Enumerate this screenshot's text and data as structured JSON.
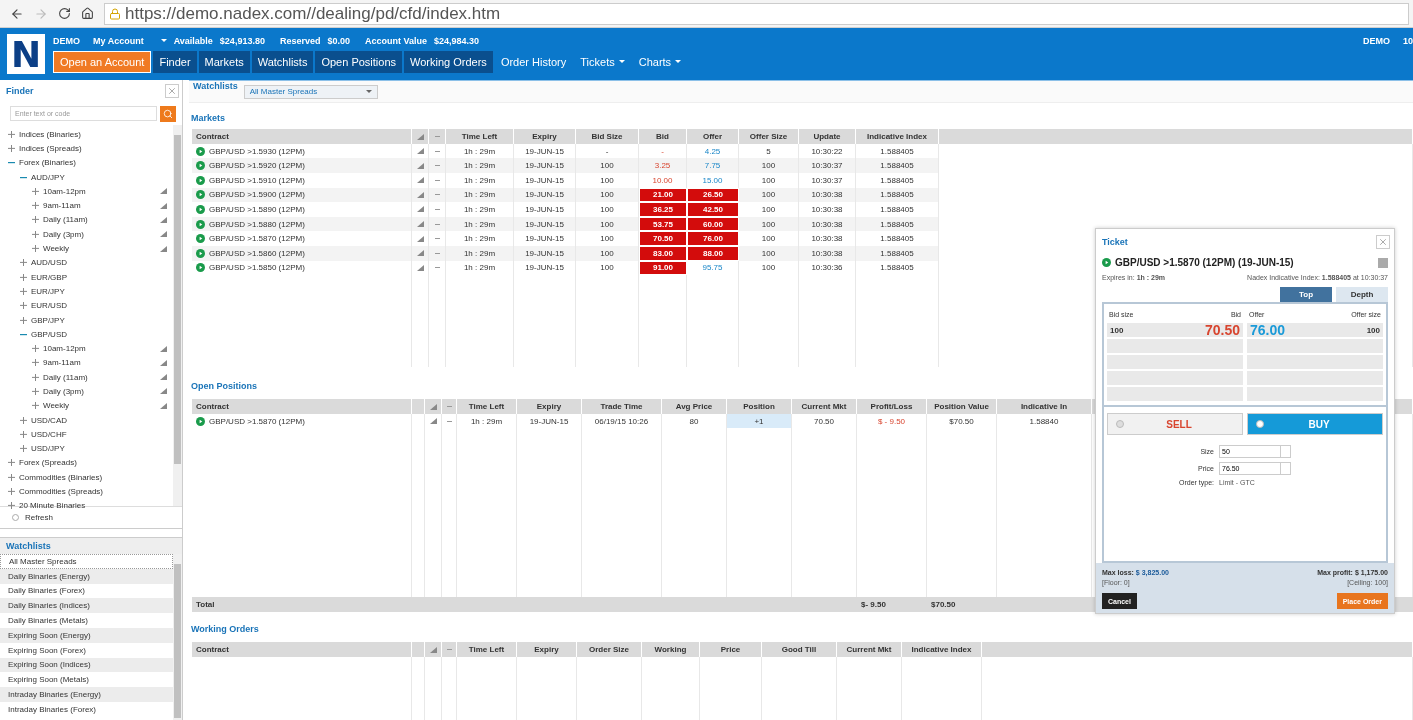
{
  "browser": {
    "url": "https://demo.nadex.com//dealing/pd/cfd/index.htm"
  },
  "header": {
    "logo": "N",
    "mode": "DEMO",
    "account_menu": "My Account",
    "available_label": "Available",
    "available": "$24,913.80",
    "reserved_label": "Reserved",
    "reserved": "$0.00",
    "account_value_label": "Account Value",
    "account_value": "$24,984.30",
    "right_mode": "DEMO",
    "right_cut": "10"
  },
  "nav": [
    {
      "label": "Open an Account",
      "kind": "cta",
      "active": false,
      "dropdown": false
    },
    {
      "label": "Finder",
      "kind": "tab",
      "active": true,
      "dropdown": false
    },
    {
      "label": "Markets",
      "kind": "tab",
      "active": true,
      "dropdown": false
    },
    {
      "label": "Watchlists",
      "kind": "tab",
      "active": true,
      "dropdown": false
    },
    {
      "label": "Open Positions",
      "kind": "tab",
      "active": true,
      "dropdown": false
    },
    {
      "label": "Working Orders",
      "kind": "tab",
      "active": true,
      "dropdown": false
    },
    {
      "label": "Order History",
      "kind": "tab",
      "active": false,
      "dropdown": false
    },
    {
      "label": "Tickets",
      "kind": "tab",
      "active": false,
      "dropdown": true
    },
    {
      "label": "Charts",
      "kind": "tab",
      "active": false,
      "dropdown": true
    }
  ],
  "finder": {
    "title": "Finder",
    "placeholder": "Enter text or code",
    "refresh": "Refresh",
    "tree": [
      {
        "label": "Indices (Binaries)",
        "kind": "group",
        "expanded": false
      },
      {
        "label": "Indices (Spreads)",
        "kind": "group",
        "expanded": false
      },
      {
        "label": "Forex (Binaries)",
        "kind": "group",
        "expanded": true,
        "children": [
          {
            "label": "AUD/JPY",
            "kind": "group",
            "expanded": true,
            "children": [
              {
                "label": "10am-12pm",
                "kind": "market",
                "expanded": false
              },
              {
                "label": "9am-11am",
                "kind": "market",
                "expanded": false
              },
              {
                "label": "Daily (11am)",
                "kind": "market",
                "expanded": false
              },
              {
                "label": "Daily (3pm)",
                "kind": "market",
                "expanded": false
              },
              {
                "label": "Weekly",
                "kind": "market",
                "expanded": false
              }
            ]
          },
          {
            "label": "AUD/USD",
            "kind": "group",
            "expanded": false
          },
          {
            "label": "EUR/GBP",
            "kind": "group",
            "expanded": false
          },
          {
            "label": "EUR/JPY",
            "kind": "group",
            "expanded": false
          },
          {
            "label": "EUR/USD",
            "kind": "group",
            "expanded": false
          },
          {
            "label": "GBP/JPY",
            "kind": "group",
            "expanded": false
          },
          {
            "label": "GBP/USD",
            "kind": "group",
            "expanded": true,
            "children": [
              {
                "label": "10am-12pm",
                "kind": "market",
                "expanded": false
              },
              {
                "label": "9am-11am",
                "kind": "market",
                "expanded": false
              },
              {
                "label": "Daily (11am)",
                "kind": "market",
                "expanded": false
              },
              {
                "label": "Daily (3pm)",
                "kind": "market",
                "expanded": false
              },
              {
                "label": "Weekly",
                "kind": "market",
                "expanded": false
              }
            ]
          },
          {
            "label": "USD/CAD",
            "kind": "group",
            "expanded": false
          },
          {
            "label": "USD/CHF",
            "kind": "group",
            "expanded": false
          },
          {
            "label": "USD/JPY",
            "kind": "group",
            "expanded": false
          }
        ]
      },
      {
        "label": "Forex (Spreads)",
        "kind": "group",
        "expanded": false
      },
      {
        "label": "Commodities (Binaries)",
        "kind": "group",
        "expanded": false
      },
      {
        "label": "Commodities (Spreads)",
        "kind": "group",
        "expanded": false
      },
      {
        "label": "20 Minute Binaries",
        "kind": "group",
        "expanded": false
      }
    ]
  },
  "watchlists": {
    "title": "Watchlists",
    "items": [
      {
        "label": "All Master Spreads",
        "selected": true
      },
      {
        "label": "Daily Binaries (Energy)",
        "selected": false
      },
      {
        "label": "Daily Binaries (Forex)",
        "selected": false
      },
      {
        "label": "Daily Binaries (Indices)",
        "selected": false
      },
      {
        "label": "Daily Binaries (Metals)",
        "selected": false
      },
      {
        "label": "Expiring Soon (Energy)",
        "selected": false
      },
      {
        "label": "Expiring Soon (Forex)",
        "selected": false
      },
      {
        "label": "Expiring Soon (Indices)",
        "selected": false
      },
      {
        "label": "Expiring Soon (Metals)",
        "selected": false
      },
      {
        "label": "Intraday Binaries (Energy)",
        "selected": false
      },
      {
        "label": "Intraday Binaries (Forex)",
        "selected": false
      }
    ]
  },
  "watchlist_bar": {
    "label": "Watchlists",
    "value": "All Master Spreads"
  },
  "markets": {
    "title": "Markets",
    "columns": [
      "Contract",
      "Time Left",
      "Expiry",
      "Bid Size",
      "Bid",
      "Offer",
      "Offer Size",
      "Update",
      "Indicative Index"
    ],
    "rows": [
      {
        "cells": [
          "GBP/USD >1.5930 (12PM)",
          "1h : 29m",
          "19-JUN-15",
          "-",
          "-",
          "4.25",
          "5",
          "10:30:22",
          "1.588405"
        ],
        "bid_flash": false,
        "offer_flash": false
      },
      {
        "cells": [
          "GBP/USD >1.5920 (12PM)",
          "1h : 29m",
          "19-JUN-15",
          "100",
          "3.25",
          "7.75",
          "100",
          "10:30:37",
          "1.588405"
        ],
        "bid_flash": false,
        "offer_flash": false
      },
      {
        "cells": [
          "GBP/USD >1.5910 (12PM)",
          "1h : 29m",
          "19-JUN-15",
          "100",
          "10.00",
          "15.00",
          "100",
          "10:30:37",
          "1.588405"
        ],
        "bid_flash": false,
        "offer_flash": false
      },
      {
        "cells": [
          "GBP/USD >1.5900 (12PM)",
          "1h : 29m",
          "19-JUN-15",
          "100",
          "21.00",
          "26.50",
          "100",
          "10:30:38",
          "1.588405"
        ],
        "bid_flash": true,
        "offer_flash": true
      },
      {
        "cells": [
          "GBP/USD >1.5890 (12PM)",
          "1h : 29m",
          "19-JUN-15",
          "100",
          "36.25",
          "42.50",
          "100",
          "10:30:38",
          "1.588405"
        ],
        "bid_flash": true,
        "offer_flash": true
      },
      {
        "cells": [
          "GBP/USD >1.5880 (12PM)",
          "1h : 29m",
          "19-JUN-15",
          "100",
          "53.75",
          "60.00",
          "100",
          "10:30:38",
          "1.588405"
        ],
        "bid_flash": true,
        "offer_flash": true
      },
      {
        "cells": [
          "GBP/USD >1.5870 (12PM)",
          "1h : 29m",
          "19-JUN-15",
          "100",
          "70.50",
          "76.00",
          "100",
          "10:30:38",
          "1.588405"
        ],
        "bid_flash": true,
        "offer_flash": true
      },
      {
        "cells": [
          "GBP/USD >1.5860 (12PM)",
          "1h : 29m",
          "19-JUN-15",
          "100",
          "83.00",
          "88.00",
          "100",
          "10:30:38",
          "1.588405"
        ],
        "bid_flash": true,
        "offer_flash": true
      },
      {
        "cells": [
          "GBP/USD >1.5850 (12PM)",
          "1h : 29m",
          "19-JUN-15",
          "100",
          "91.00",
          "95.75",
          "100",
          "10:30:36",
          "1.588405"
        ],
        "bid_flash": true,
        "offer_flash": false
      }
    ]
  },
  "open_positions": {
    "title": "Open Positions",
    "columns": [
      "Contract",
      "Time Left",
      "Expiry",
      "Trade Time",
      "Avg Price",
      "Position",
      "Current Mkt",
      "Profit/Loss",
      "Position Value",
      "Indicative In"
    ],
    "rows": [
      {
        "cells": [
          "GBP/USD >1.5870 (12PM)",
          "1h : 29m",
          "19-JUN-15",
          "06/19/15 10:26",
          "80",
          "+1",
          "70.50",
          "$ - 9.50",
          "$70.50",
          "1.58840"
        ]
      }
    ],
    "total": {
      "label": "Total",
      "profit_loss": "$- 9.50",
      "position_value": "$70.50"
    }
  },
  "working_orders": {
    "title": "Working Orders",
    "columns": [
      "Contract",
      "Time Left",
      "Expiry",
      "Order Size",
      "Working",
      "Price",
      "Good Till",
      "Current Mkt",
      "Indicative Index"
    ]
  },
  "ticket": {
    "title": "Ticket",
    "contract": "GBP/USD >1.5870 (12PM) (19-JUN-15)",
    "expires_label": "Expires in:",
    "expires": "1h : 29m",
    "index_label": "Nadex Indicative Index:",
    "index": "1.588405",
    "index_time": "at 10:30:37",
    "tabs": [
      {
        "label": "Top",
        "selected": true
      },
      {
        "label": "Depth",
        "selected": false
      }
    ],
    "depth_headers": [
      "Bid size",
      "Bid",
      "Offer",
      "Offer size"
    ],
    "depth_row": [
      "100",
      "70.50",
      "76.00",
      "100"
    ],
    "sides": [
      {
        "label": "SELL",
        "kind": "sell",
        "selected": false
      },
      {
        "label": "BUY",
        "kind": "buy",
        "selected": true
      }
    ],
    "size_label": "Size",
    "size": "50",
    "price_label": "Price",
    "price": "76.50",
    "order_type_label": "Order type:",
    "order_type": "Limit - GTC",
    "max_loss_label": "Max loss:",
    "max_loss": "$ 3,825.00",
    "floor": "[Floor: 0]",
    "max_profit_label": "Max profit:",
    "max_profit": "$ 1,175.00",
    "ceiling": "[Ceiling: 100]",
    "cancel": "Cancel",
    "place_order": "Place Order"
  }
}
